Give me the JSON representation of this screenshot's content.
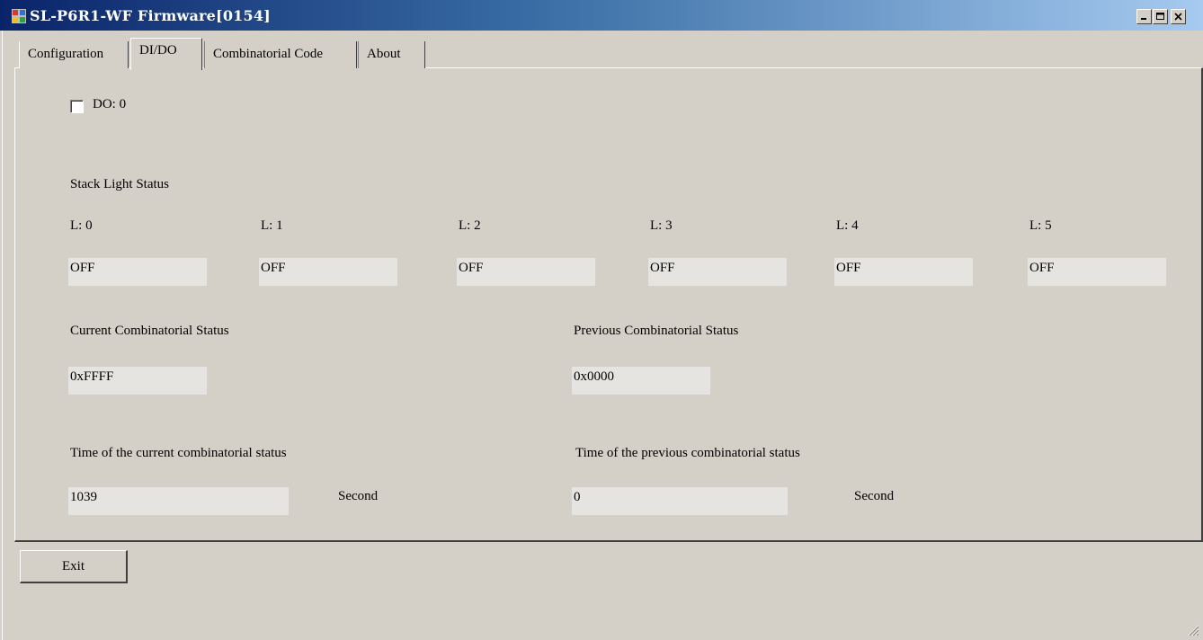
{
  "window": {
    "title": "SL-P6R1-WF Firmware[0154]"
  },
  "tabs": [
    {
      "label": "Configuration"
    },
    {
      "label": "DI/DO"
    },
    {
      "label": "Combinatorial Code"
    },
    {
      "label": "About"
    }
  ],
  "do_checkbox": {
    "label": "DO: 0",
    "checked": false
  },
  "stack_light": {
    "heading": "Stack Light Status",
    "lights": [
      {
        "label": "L: 0",
        "value": "OFF"
      },
      {
        "label": "L: 1",
        "value": "OFF"
      },
      {
        "label": "L: 2",
        "value": "OFF"
      },
      {
        "label": "L: 3",
        "value": "OFF"
      },
      {
        "label": "L: 4",
        "value": "OFF"
      },
      {
        "label": "L: 5",
        "value": "OFF"
      }
    ]
  },
  "current_status": {
    "label": "Current Combinatorial Status",
    "value": "0xFFFF"
  },
  "previous_status": {
    "label": "Previous Combinatorial Status",
    "value": "0x0000"
  },
  "current_time": {
    "label": "Time of the current combinatorial status",
    "value": "1039",
    "unit": "Second"
  },
  "previous_time": {
    "label": "Time of the previous combinatorial status",
    "value": "0",
    "unit": "Second"
  },
  "exit_button": {
    "label": "Exit"
  }
}
